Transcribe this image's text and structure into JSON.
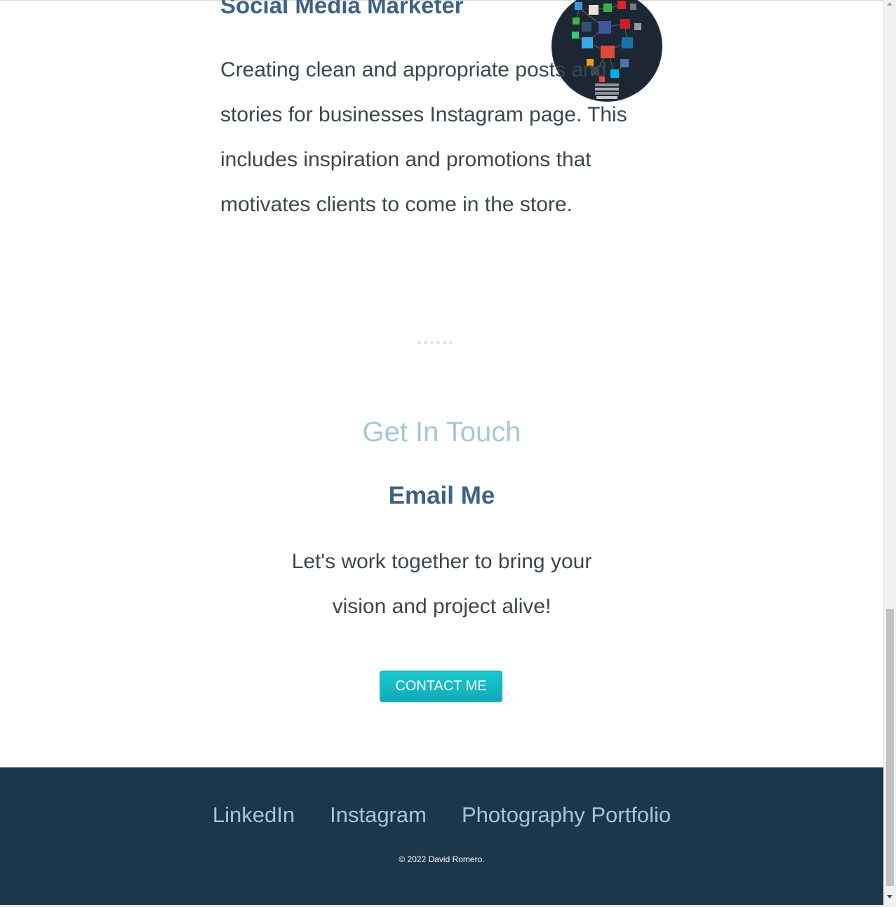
{
  "experience": {
    "job_title": "Social Media Marketer",
    "image_icon": "social-media-lightbulb-icon",
    "description": "Creating clean and appropriate posts and stories for businesses Instagram page. This includes inspiration and promotions that motivates clients to come in the store."
  },
  "contact": {
    "heading": "Get In Touch",
    "subheading": "Email Me",
    "text": "Let's work together to bring your vision and project alive!",
    "button_label": "CONTACT ME"
  },
  "footer": {
    "links": [
      "LinkedIn",
      "Instagram",
      "Photography Portfolio"
    ],
    "copyright": "© 2022 David Romero."
  },
  "colors": {
    "heading_blue": "#3f6283",
    "light_blue": "#a7c7d8",
    "body_text": "#3a4750",
    "button": "#18c9d0",
    "footer_bg": "#1c364c"
  }
}
